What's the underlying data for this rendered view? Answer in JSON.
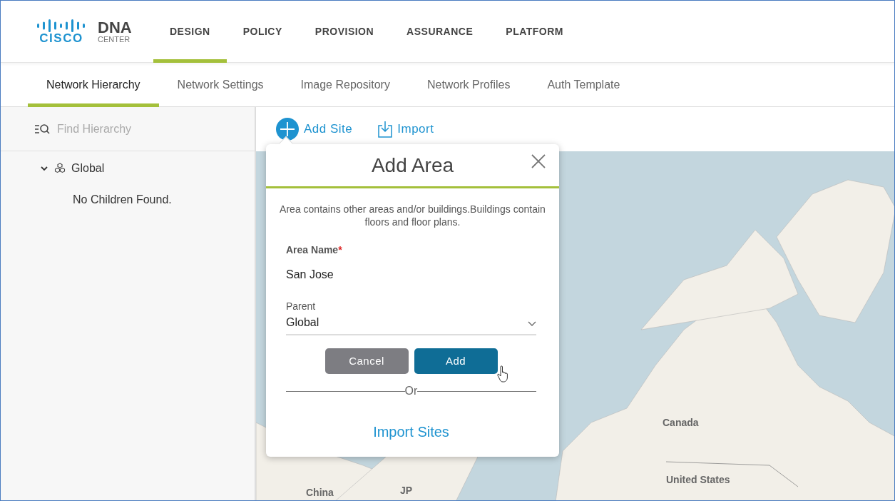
{
  "brand": {
    "logo": "CISCO",
    "product": "DNA",
    "product_sub": "CENTER"
  },
  "main_tabs": [
    {
      "label": "DESIGN",
      "selected": true
    },
    {
      "label": "POLICY",
      "selected": false
    },
    {
      "label": "PROVISION",
      "selected": false
    },
    {
      "label": "ASSURANCE",
      "selected": false
    },
    {
      "label": "PLATFORM",
      "selected": false
    }
  ],
  "sub_tabs": [
    {
      "label": "Network Hierarchy",
      "selected": true
    },
    {
      "label": "Network Settings",
      "selected": false
    },
    {
      "label": "Image Repository",
      "selected": false
    },
    {
      "label": "Network Profiles",
      "selected": false
    },
    {
      "label": "Auth Template",
      "selected": false
    }
  ],
  "sidebar": {
    "search_placeholder": "Find Hierarchy",
    "tree": [
      {
        "label": "Global",
        "expanded": true
      }
    ],
    "empty_message": "No Children Found."
  },
  "toolbar": [
    {
      "kind": "add",
      "label": "Add Site"
    },
    {
      "kind": "import",
      "label": "Import"
    }
  ],
  "map": {
    "labels": [
      "Canada",
      "United States",
      "China",
      "JP"
    ]
  },
  "dialog": {
    "title": "Add Area",
    "description": "Area contains other areas and/or buildings.Buildings contain floors and floor plans.",
    "fields": [
      {
        "kind": "text",
        "label": "Area Name",
        "required_mark": "*",
        "value": "San Jose"
      },
      {
        "kind": "select",
        "label": "Parent",
        "value": "Global"
      }
    ],
    "buttons": [
      {
        "kind": "secondary",
        "label": "Cancel"
      },
      {
        "kind": "primary",
        "label": "Add"
      }
    ],
    "separator": "Or",
    "link": "Import Sites"
  }
}
